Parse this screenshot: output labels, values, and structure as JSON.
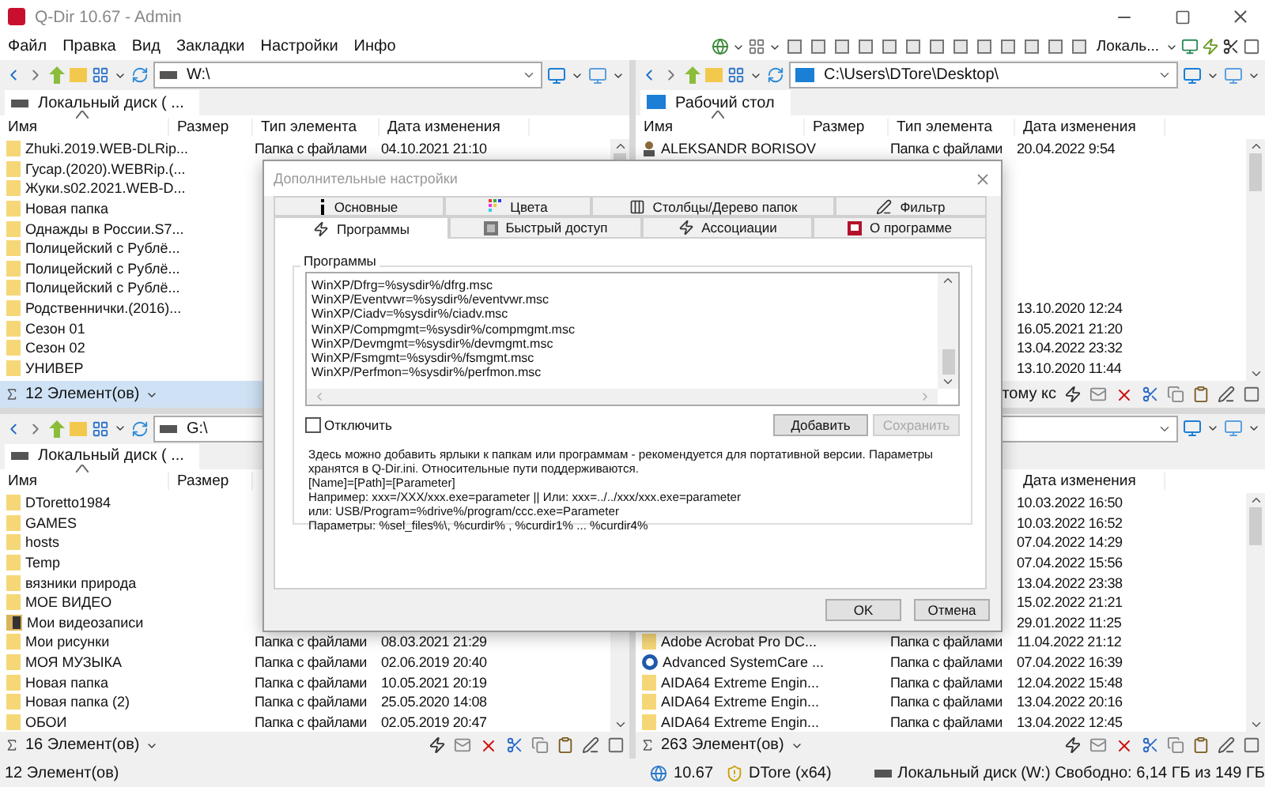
{
  "window": {
    "title": "Q-Dir 10.67 - Admin"
  },
  "menu": [
    "Файл",
    "Правка",
    "Вид",
    "Закладки",
    "Настройки",
    "Инфо"
  ],
  "toolbar": {
    "location": "Локаль..."
  },
  "panes": [
    {
      "active": true,
      "address": "W:\\",
      "tab": {
        "label": "Локальный диск ( ...",
        "selected": true,
        "kind": "drive"
      },
      "columns": {
        "name": "Имя",
        "size": "Размер",
        "type": "Тип элемента",
        "date": "Дата изменения"
      },
      "rows": [
        {
          "kind": "folder",
          "name": "Zhuki.2019.WEB-DLRip...",
          "type": "Папка с файлами",
          "date": "04.10.2021 21:10"
        },
        {
          "kind": "folder",
          "name": "Гусар.(2020).WEBRip.(..."
        },
        {
          "kind": "folder",
          "name": "Жуки.s02.2021.WEB-D..."
        },
        {
          "kind": "folder",
          "name": "Новая папка"
        },
        {
          "kind": "folder",
          "name": "Однажды в России.S7..."
        },
        {
          "kind": "folder",
          "name": "Полицейский с Рублё..."
        },
        {
          "kind": "folder",
          "name": "Полицейский с Рублё..."
        },
        {
          "kind": "folder",
          "name": "Полицейский с Рублё..."
        },
        {
          "kind": "folder",
          "name": "Родственнички.(2016)..."
        },
        {
          "kind": "folder",
          "name": "Сезон 01"
        },
        {
          "kind": "folder",
          "name": "Сезон 02"
        },
        {
          "kind": "folder",
          "name": "УНИВЕР"
        }
      ],
      "footer": {
        "count": "12 Элемент(ов)"
      }
    },
    {
      "active": false,
      "address": "C:\\Users\\DTore\\Desktop\\",
      "tab": {
        "label": "Рабочий стол",
        "selected": true,
        "kind": "desktop"
      },
      "columns": {
        "name": "Имя",
        "size": "Размер",
        "type": "Тип элемента",
        "date": "Дата изменения"
      },
      "rows": [
        {
          "kind": "user",
          "name": "ALEKSANDR BORISOV",
          "type": "Папка с файлами",
          "date": "20.04.2022 9:54"
        },
        {},
        {},
        {},
        {},
        {},
        {},
        {},
        {
          "date": "13.10.2020 12:24"
        },
        {
          "date": "16.05.2021 21:20"
        },
        {
          "date": "13.04.2022 23:32"
        },
        {
          "date": "13.10.2020 11:44"
        }
      ],
      "footer": {
        "info": "тому кс"
      }
    },
    {
      "active": false,
      "address": "G:\\",
      "tab": {
        "label": "Локальный диск ( ...",
        "selected": true,
        "kind": "drive"
      },
      "columns": {
        "name": "Имя",
        "size": "Размер"
      },
      "rows": [
        {
          "kind": "folder",
          "name": "DToretto1984"
        },
        {
          "kind": "folder",
          "name": "GAMES"
        },
        {
          "kind": "folder",
          "name": "hosts"
        },
        {
          "kind": "folder",
          "name": "Temp"
        },
        {
          "kind": "folder",
          "name": "вязники природа"
        },
        {
          "kind": "folder",
          "name": "МОЕ ВИДЕО"
        },
        {
          "kind": "video",
          "name": "Мои видеозаписи"
        },
        {
          "kind": "folder",
          "name": "Мои рисунки",
          "type": "Папка с файлами",
          "date": "08.03.2021 21:29"
        },
        {
          "kind": "folder",
          "name": "МОЯ МУЗЫКА",
          "type": "Папка с файлами",
          "date": "02.06.2019 20:40"
        },
        {
          "kind": "folder",
          "name": "Новая папка",
          "type": "Папка с файлами",
          "date": "10.05.2021 20:19"
        },
        {
          "kind": "folder",
          "name": "Новая папка (2)",
          "type": "Папка с файлами",
          "date": "25.05.2020 14:08"
        },
        {
          "kind": "folder",
          "name": "ОБОИ",
          "type": "Папка с файлами",
          "date": "02.05.2019 20:47"
        }
      ],
      "footer": {
        "count": "16 Элемент(ов)"
      }
    },
    {
      "active": false,
      "columns": {
        "date": "Дата изменения"
      },
      "rows": [
        {
          "date": "10.03.2022 16:50"
        },
        {
          "date": "10.03.2022 16:52"
        },
        {
          "date": "07.04.2022 14:29"
        },
        {
          "date": "07.04.2022 15:56"
        },
        {
          "date": "13.04.2022 23:38"
        },
        {
          "date": "15.02.2022 21:21"
        },
        {
          "date": "29.01.2022 11:25"
        },
        {
          "kind": "folder",
          "name": "Adobe Acrobat Pro DC...",
          "type": "Папка с файлами",
          "date": "11.04.2022 21:12"
        },
        {
          "kind": "app",
          "name": "Advanced SystemCare ...",
          "type": "Папка с файлами",
          "date": "07.04.2022 16:39"
        },
        {
          "kind": "folder",
          "name": "AIDA64 Extreme  Engin...",
          "type": "Папка с файлами",
          "date": "12.04.2022 15:48"
        },
        {
          "kind": "folder",
          "name": "AIDA64 Extreme  Engin...",
          "type": "Папка с файлами",
          "date": "13.04.2022 20:16"
        },
        {
          "kind": "folder",
          "name": "AIDA64 Extreme Engin...",
          "type": "Папка с файлами",
          "date": "13.04.2022 12:45"
        }
      ],
      "footer": {
        "count": "263 Элемент(ов)"
      }
    }
  ],
  "dialog": {
    "title": "Дополнительные настройки",
    "tab_rows": [
      [
        {
          "label": "Основные",
          "selected": false
        },
        {
          "label": "Цвета",
          "selected": false
        },
        {
          "label": "Столбцы/Дерево папок",
          "selected": false
        },
        {
          "label": "Фильтр",
          "selected": false
        }
      ],
      [
        {
          "label": "Программы",
          "selected": true
        },
        {
          "label": "Быстрый доступ",
          "selected": false
        },
        {
          "label": "Ассоциации",
          "selected": false
        },
        {
          "label": "О программе",
          "selected": false
        }
      ]
    ],
    "group_label": "Программы",
    "entries": [
      "WinXP/Dfrg=%sysdir%/dfrg.msc",
      "WinXP/Eventvwr=%sysdir%/eventvwr.msc",
      "WinXP/Ciadv=%sysdir%/ciadv.msc",
      "WinXP/Compmgmt=%sysdir%/compmgmt.msc",
      "WinXP/Devmgmt=%sysdir%/devmgmt.msc",
      "WinXP/Fsmgmt=%sysdir%/fsmgmt.msc",
      "WinXP/Perfmon=%sysdir%/perfmon.msc"
    ],
    "disable": {
      "label": "Отключить",
      "checked": false
    },
    "buttons": [
      {
        "label": "Добавить",
        "disabled": false
      },
      {
        "label": "Сохранить",
        "disabled": true
      }
    ],
    "description": [
      "Здесь можно добавить ярлыки к папкам или программам - рекомендуется для портативной версии. Параметры",
      "хранятся в Q-Dir.ini. Относительные пути поддерживаются.",
      "[Name]=[Path]=[Parameter]",
      "Например: xxx=/XXX/xxx.exe=parameter || Или: xxx=../../xxx/xxx.exe=parameter",
      "или: USB/Program=%drive%/program/ccc.exe=Parameter",
      "Параметры: %sel_files%\\, %curdir% , %curdir1% ... %curdir4%"
    ],
    "footer_buttons": [
      "OK",
      "Отмена"
    ]
  },
  "status_bar": {
    "count": "12 Элемент(ов)",
    "version": "10.67",
    "user": "DTore (x64)",
    "drive": "Локальный диск (W:) Свободно: 6,14 ГБ из 149 ГБ"
  }
}
